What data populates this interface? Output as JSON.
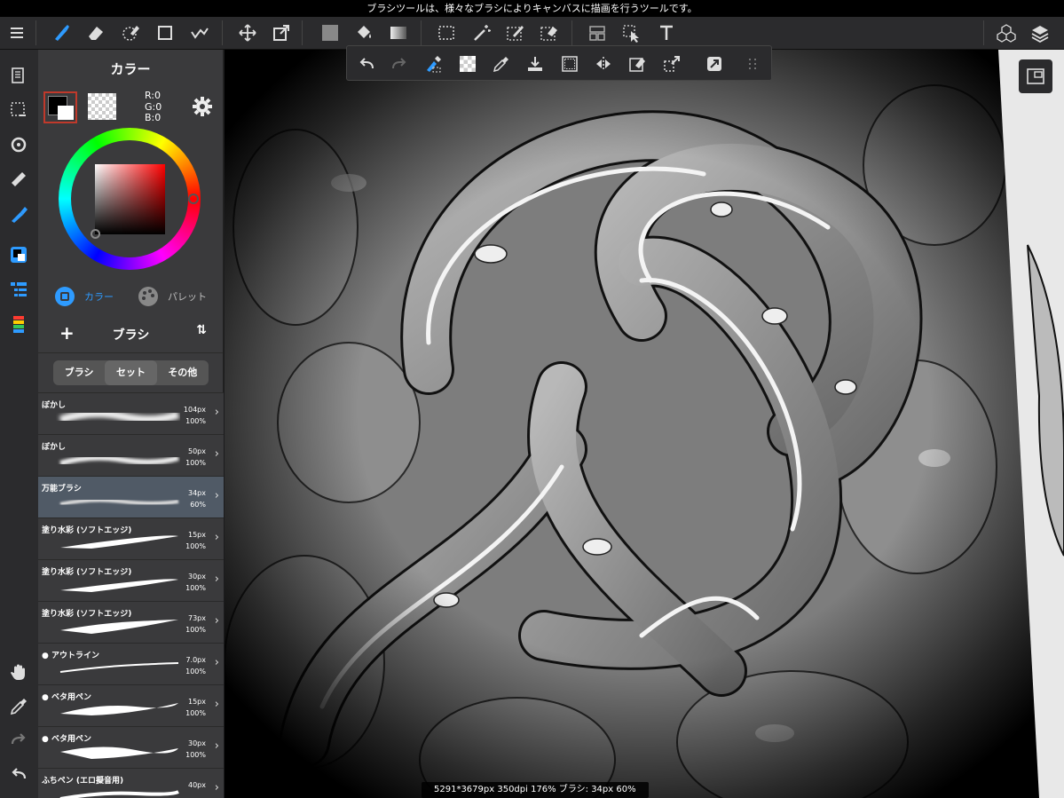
{
  "tip": "ブラシツールは、様々なブラシによりキャンバスに描画を行うツールです。",
  "color_panel": {
    "title": "カラー",
    "rgb": {
      "r": "R:0",
      "g": "G:0",
      "b": "B:0"
    },
    "tab_color": "カラー",
    "tab_palette": "パレット"
  },
  "brush_panel": {
    "title": "ブラシ",
    "add": "+",
    "sort": "⇅",
    "segments": [
      "ブラシ",
      "セット",
      "その他"
    ],
    "items": [
      {
        "name": "ぼかし",
        "size": "104px",
        "opacity": "100%"
      },
      {
        "name": "ぼかし",
        "size": "50px",
        "opacity": "100%"
      },
      {
        "name": "万能ブラシ",
        "size": "34px",
        "opacity": "60%"
      },
      {
        "name": "塗り水彩 (ソフトエッジ)",
        "size": "15px",
        "opacity": "100%"
      },
      {
        "name": "塗り水彩 (ソフトエッジ)",
        "size": "30px",
        "opacity": "100%"
      },
      {
        "name": "塗り水彩 (ソフトエッジ)",
        "size": "73px",
        "opacity": "100%"
      },
      {
        "name": "● アウトライン",
        "size": "7.0px",
        "opacity": "100%"
      },
      {
        "name": "● ベタ用ペン",
        "size": "15px",
        "opacity": "100%"
      },
      {
        "name": "● ベタ用ペン",
        "size": "30px",
        "opacity": "100%"
      },
      {
        "name": "ふちペン (エロ擬音用)",
        "size": "40px",
        "opacity": ""
      }
    ]
  },
  "status": "5291*3679px 350dpi 176% ブラシ: 34px 60%",
  "colors": {
    "accent": "#2e9bff",
    "selected_row": "#505a66",
    "panel": "#3a3a3c"
  }
}
